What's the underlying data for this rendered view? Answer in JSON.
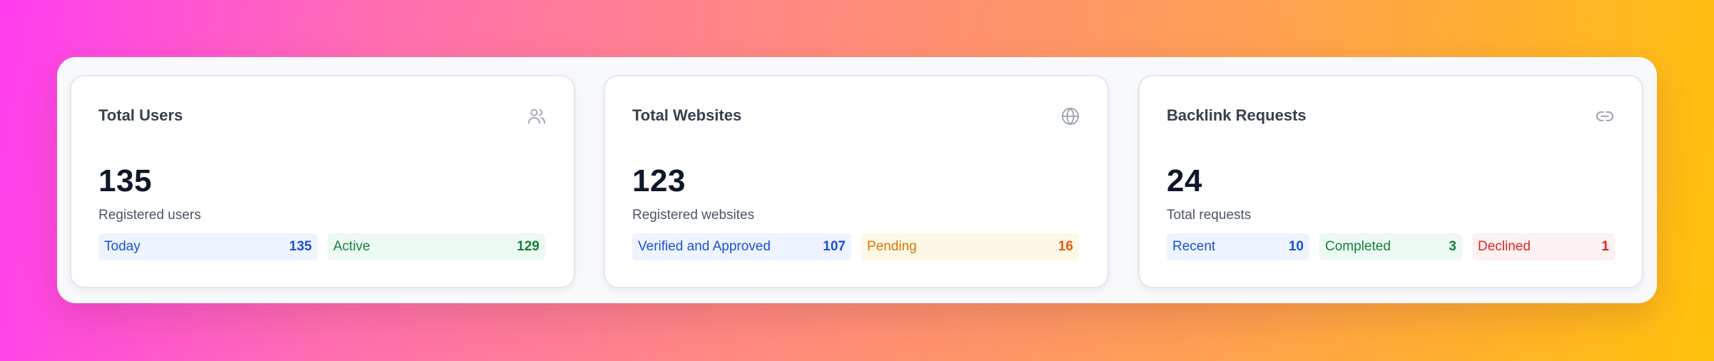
{
  "cards": [
    {
      "title": "Total Users",
      "icon": "users-icon",
      "value": "135",
      "subtitle": "Registered users",
      "chips": [
        {
          "label": "Today",
          "count": "135",
          "color": "#1d4ed8"
        },
        {
          "label": "Active",
          "count": "129",
          "color": "#15803d"
        }
      ]
    },
    {
      "title": "Total Websites",
      "icon": "globe-icon",
      "value": "123",
      "subtitle": "Registered websites",
      "chips": [
        {
          "label": "Verified and Approved",
          "count": "107",
          "color": "#1d4ed8"
        },
        {
          "label": "Pending",
          "count": "16",
          "color": "#d97706"
        }
      ]
    },
    {
      "title": "Backlink Requests",
      "icon": "link-icon",
      "value": "24",
      "subtitle": "Total requests",
      "chips": [
        {
          "label": "Recent",
          "count": "10",
          "color": "#1d4ed8"
        },
        {
          "label": "Completed",
          "count": "3",
          "color": "#15803d"
        },
        {
          "label": "Declined",
          "count": "1",
          "color": "#dc2626"
        }
      ]
    }
  ]
}
